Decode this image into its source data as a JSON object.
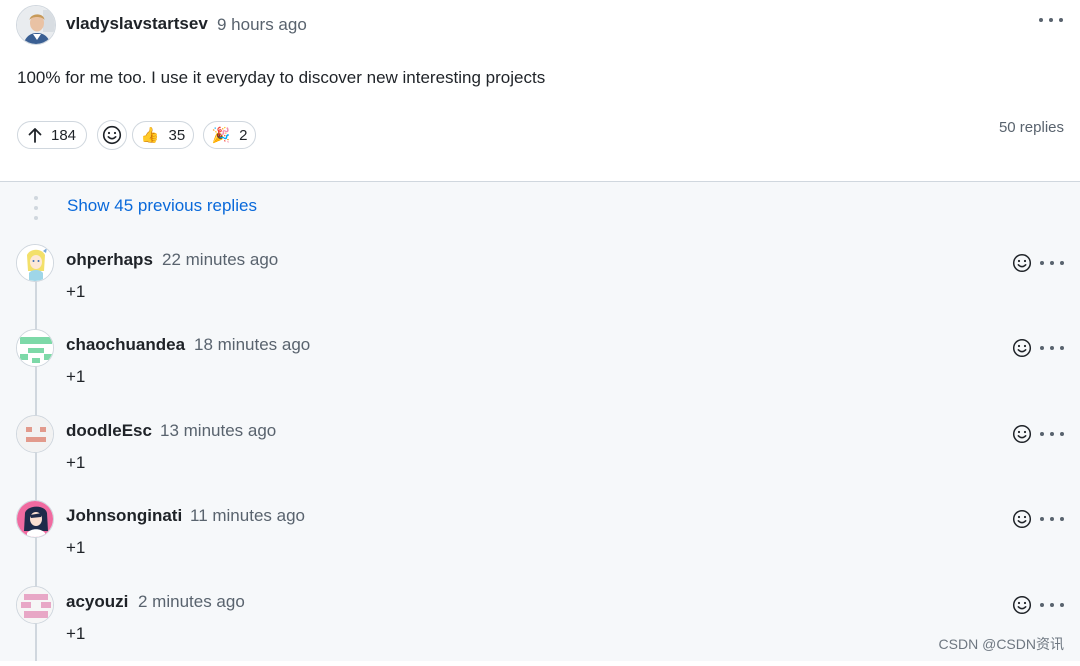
{
  "comment": {
    "author": "vladyslavstartsev",
    "time": "9 hours ago",
    "body": "100% for me too. I use it everyday to discover new interesting projects",
    "upvotes": "184",
    "reactions": [
      {
        "icon": "thumbs-up-icon",
        "glyph": "👍",
        "count": "35"
      },
      {
        "icon": "party-popper-icon",
        "glyph": "🎉",
        "count": "2"
      }
    ],
    "replies_count": "50 replies"
  },
  "thread": {
    "show_previous": "Show 45 previous replies",
    "replies": [
      {
        "author": "ohperhaps",
        "time": "22 minutes ago",
        "body": "+1"
      },
      {
        "author": "chaochuandea",
        "time": "18 minutes ago",
        "body": "+1"
      },
      {
        "author": "doodleEsc",
        "time": "13 minutes ago",
        "body": "+1"
      },
      {
        "author": "Johnsonginati",
        "time": "11 minutes ago",
        "body": "+1"
      },
      {
        "author": "acyouzi",
        "time": "2 minutes ago",
        "body": "+1"
      }
    ]
  },
  "watermark": "CSDN @CSDN资讯"
}
